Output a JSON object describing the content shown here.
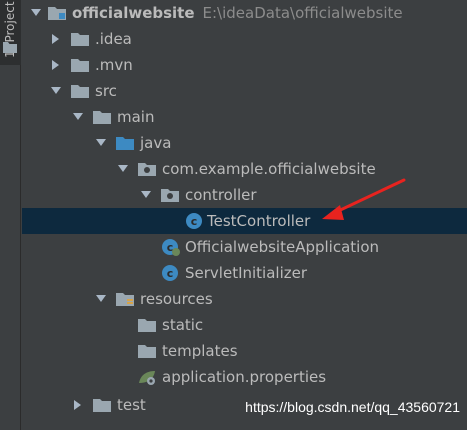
{
  "side_tab": {
    "label": "1: Project"
  },
  "tree": {
    "root": {
      "label": "officialwebsite",
      "path": "E:\\ideaData\\officialwebsite"
    },
    "idea": {
      "label": ".idea"
    },
    "mvn": {
      "label": ".mvn"
    },
    "src": {
      "label": "src"
    },
    "main": {
      "label": "main"
    },
    "java": {
      "label": "java"
    },
    "package": {
      "label": "com.example.officialwebsite"
    },
    "controller": {
      "label": "controller"
    },
    "test_controller": {
      "label": "TestController"
    },
    "app_class": {
      "label": "OfficialwebsiteApplication"
    },
    "servlet_init": {
      "label": "ServletInitializer"
    },
    "resources": {
      "label": "resources"
    },
    "static": {
      "label": "static"
    },
    "templates": {
      "label": "templates"
    },
    "app_props": {
      "label": "application.properties"
    },
    "test": {
      "label": "test"
    }
  },
  "annotation": {
    "arrow_color": "#e8231f"
  },
  "watermark": "https://blog.csdn.net/qq_43560721",
  "colors": {
    "background": "#3c3f41",
    "selection": "#0d293e",
    "text": "#bbbbbb",
    "folder": "#9aa7b0",
    "java_source_folder": "#3d8ac2",
    "class_icon": "#3d8ac2"
  }
}
